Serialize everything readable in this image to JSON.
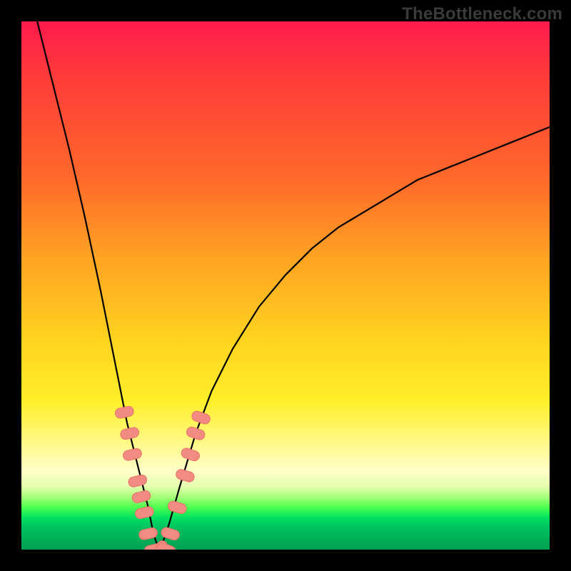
{
  "watermark": {
    "text": "TheBottleneck.com"
  },
  "palette": {
    "curve_stroke": "#000000",
    "marker_fill": "#f28b82",
    "marker_stroke": "#e57368",
    "gradient_top": "#ff1a4d",
    "gradient_mid1": "#ffa423",
    "gradient_mid2": "#ffef2a",
    "gradient_green": "#00c060"
  },
  "chart_data": {
    "type": "line",
    "title": "",
    "xlabel": "",
    "ylabel": "",
    "xlim": [
      0,
      100
    ],
    "ylim": [
      0,
      100
    ],
    "x_min_point": 26,
    "notes": "V-shaped bottleneck curve. Minimum (y≈0) occurs near x≈26 on a 0–100 axis. Left branch is steep; right branch rises asymptotically toward ~80 at x=100. Background is a vertical heat gradient (red→green). Values estimated from pixel positions against implicit 0–100 grid.",
    "series": [
      {
        "name": "bottleneck-curve",
        "x": [
          3,
          6,
          9,
          12,
          15,
          18,
          20,
          22,
          24,
          25,
          26,
          27,
          28,
          30,
          33,
          36,
          40,
          45,
          50,
          55,
          60,
          65,
          70,
          75,
          80,
          85,
          90,
          95,
          100
        ],
        "y": [
          100,
          88,
          76,
          63,
          49,
          34,
          24,
          16,
          8,
          3,
          0,
          2,
          5,
          12,
          22,
          30,
          38,
          46,
          52,
          57,
          61,
          64,
          67,
          70,
          72,
          74,
          76,
          78,
          80
        ]
      }
    ],
    "markers": {
      "name": "highlight-pills",
      "note": "Clustered salmon capsule markers near the trough on both branches, plus a few at the very bottom (y≈0).",
      "points": [
        {
          "x": 19.5,
          "y": 26
        },
        {
          "x": 20.5,
          "y": 22
        },
        {
          "x": 21.0,
          "y": 18
        },
        {
          "x": 22.0,
          "y": 13
        },
        {
          "x": 22.7,
          "y": 10
        },
        {
          "x": 23.3,
          "y": 7
        },
        {
          "x": 24.0,
          "y": 3
        },
        {
          "x": 25.0,
          "y": 0
        },
        {
          "x": 26.3,
          "y": 0
        },
        {
          "x": 27.5,
          "y": 0
        },
        {
          "x": 28.2,
          "y": 3
        },
        {
          "x": 29.5,
          "y": 8
        },
        {
          "x": 31.0,
          "y": 14
        },
        {
          "x": 32.0,
          "y": 18
        },
        {
          "x": 33.0,
          "y": 22
        },
        {
          "x": 34.0,
          "y": 25
        }
      ]
    }
  }
}
